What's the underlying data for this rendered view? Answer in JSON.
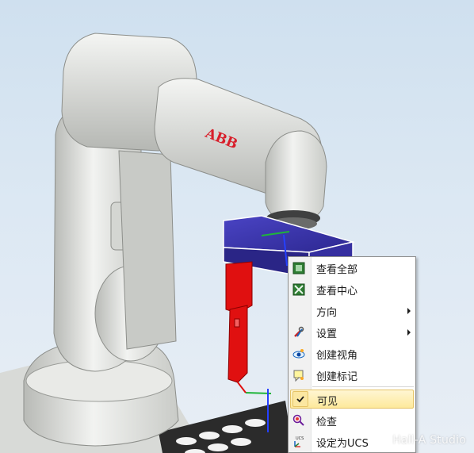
{
  "scene": {
    "robot_brand_label": "ABB",
    "colors": {
      "robot_body": "#e8e9e6",
      "robot_shadow": "#9a9c98",
      "tool_blue": "#3b35a8",
      "gripper_red": "#e01010",
      "background_top": "#cfe0ef"
    }
  },
  "context_menu": {
    "items": [
      {
        "label": "查看全部",
        "icon": "view-all-icon",
        "has_submenu": false
      },
      {
        "label": "查看中心",
        "icon": "view-center-icon",
        "has_submenu": false
      },
      {
        "label": "方向",
        "icon": "",
        "has_submenu": true
      },
      {
        "label": "设置",
        "icon": "settings-tools-icon",
        "has_submenu": true
      },
      {
        "label": "创建视角",
        "icon": "create-view-eye-icon",
        "has_submenu": false
      },
      {
        "label": "创建标记",
        "icon": "create-marker-icon",
        "has_submenu": false
      },
      {
        "label": "可见",
        "icon": "checkmark-icon",
        "has_submenu": false,
        "checked": true,
        "highlighted": true
      },
      {
        "label": "检查",
        "icon": "inspect-icon",
        "has_submenu": false
      },
      {
        "label": "设定为UCS",
        "icon": "set-ucs-icon",
        "has_submenu": false
      }
    ]
  },
  "watermark": "Hall-A Studio"
}
